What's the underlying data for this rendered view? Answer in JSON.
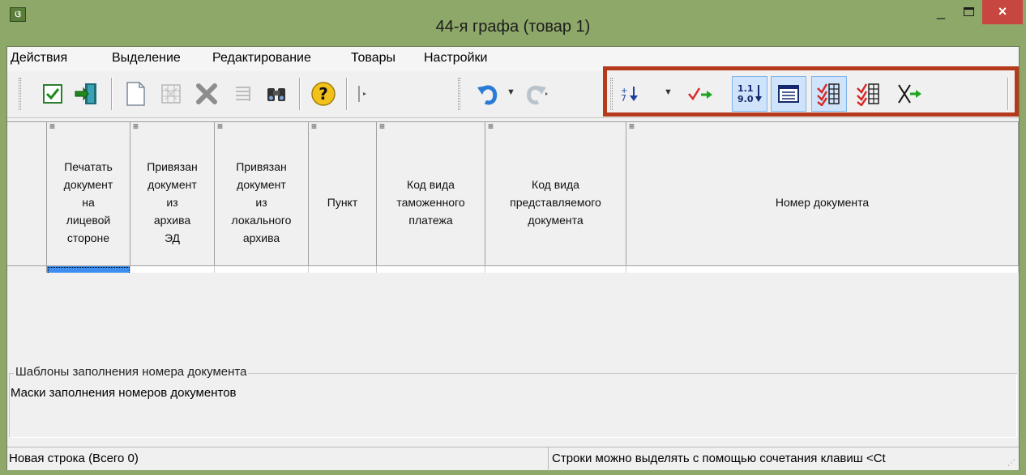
{
  "window": {
    "title": "44-я графа (товар 1)",
    "minimize_glyph": "_",
    "close_glyph": "×",
    "app_icon_text": "ଓ"
  },
  "menu": {
    "items": [
      "Действия",
      "Выделение",
      "Редактирование",
      "Товары",
      "Настройки"
    ]
  },
  "toolbar": {
    "buttons": [
      {
        "name": "checkmark-icon",
        "pressed": false
      },
      {
        "name": "exit-door-icon",
        "pressed": false
      },
      {
        "name": "new-document-icon",
        "pressed": false
      },
      {
        "name": "disabled-grid-icon",
        "pressed": false
      },
      {
        "name": "delete-x-icon",
        "pressed": false
      },
      {
        "name": "disabled-list-icon",
        "pressed": false
      },
      {
        "name": "binoculars-icon",
        "pressed": false
      },
      {
        "name": "help-icon",
        "pressed": false
      },
      {
        "name": "disabled-bar-icon",
        "pressed": false
      },
      {
        "name": "undo-icon",
        "pressed": false
      },
      {
        "name": "redo-icon",
        "pressed": false
      },
      {
        "name": "sort-down-icon",
        "pressed": false
      },
      {
        "name": "check-arrow-icon",
        "pressed": false
      },
      {
        "name": "number-sort-icon",
        "pressed": true,
        "label_top": "1.1",
        "label_bottom": "9.0"
      },
      {
        "name": "form-view-icon",
        "pressed": true
      },
      {
        "name": "check-all-icon",
        "pressed": true
      },
      {
        "name": "check-all-red-icon",
        "pressed": false
      },
      {
        "name": "clear-selection-icon",
        "pressed": false
      }
    ],
    "highlight_color": "#b53a1b",
    "pressed_color": "#cfe4fb"
  },
  "grid": {
    "column_mark": "≡",
    "columns": [
      "Печатать\nдокумент\nна\nлицевой\nстороне",
      "Привязан\nдокумент\nиз\nархива\nЭД",
      "Привязан\nдокумент\nиз\nлокального\nархива",
      "Пункт",
      "Код вида\nтаможенного\nплатежа",
      "Код вида\nпредставляемого\nдокумента",
      "Номер документа"
    ],
    "active_cell_color": "#3d8ef0"
  },
  "scrollbar": {
    "left_arrow": "<",
    "right_arrow": ">"
  },
  "templates_panel": {
    "title": "Шаблоны заполнения номера документа",
    "subtitle": "Маски заполнения номеров документов"
  },
  "status": {
    "left": "Новая строка (Всего 0)",
    "right": "Строки можно выделять с помощью сочетания клавиш <Ct"
  }
}
